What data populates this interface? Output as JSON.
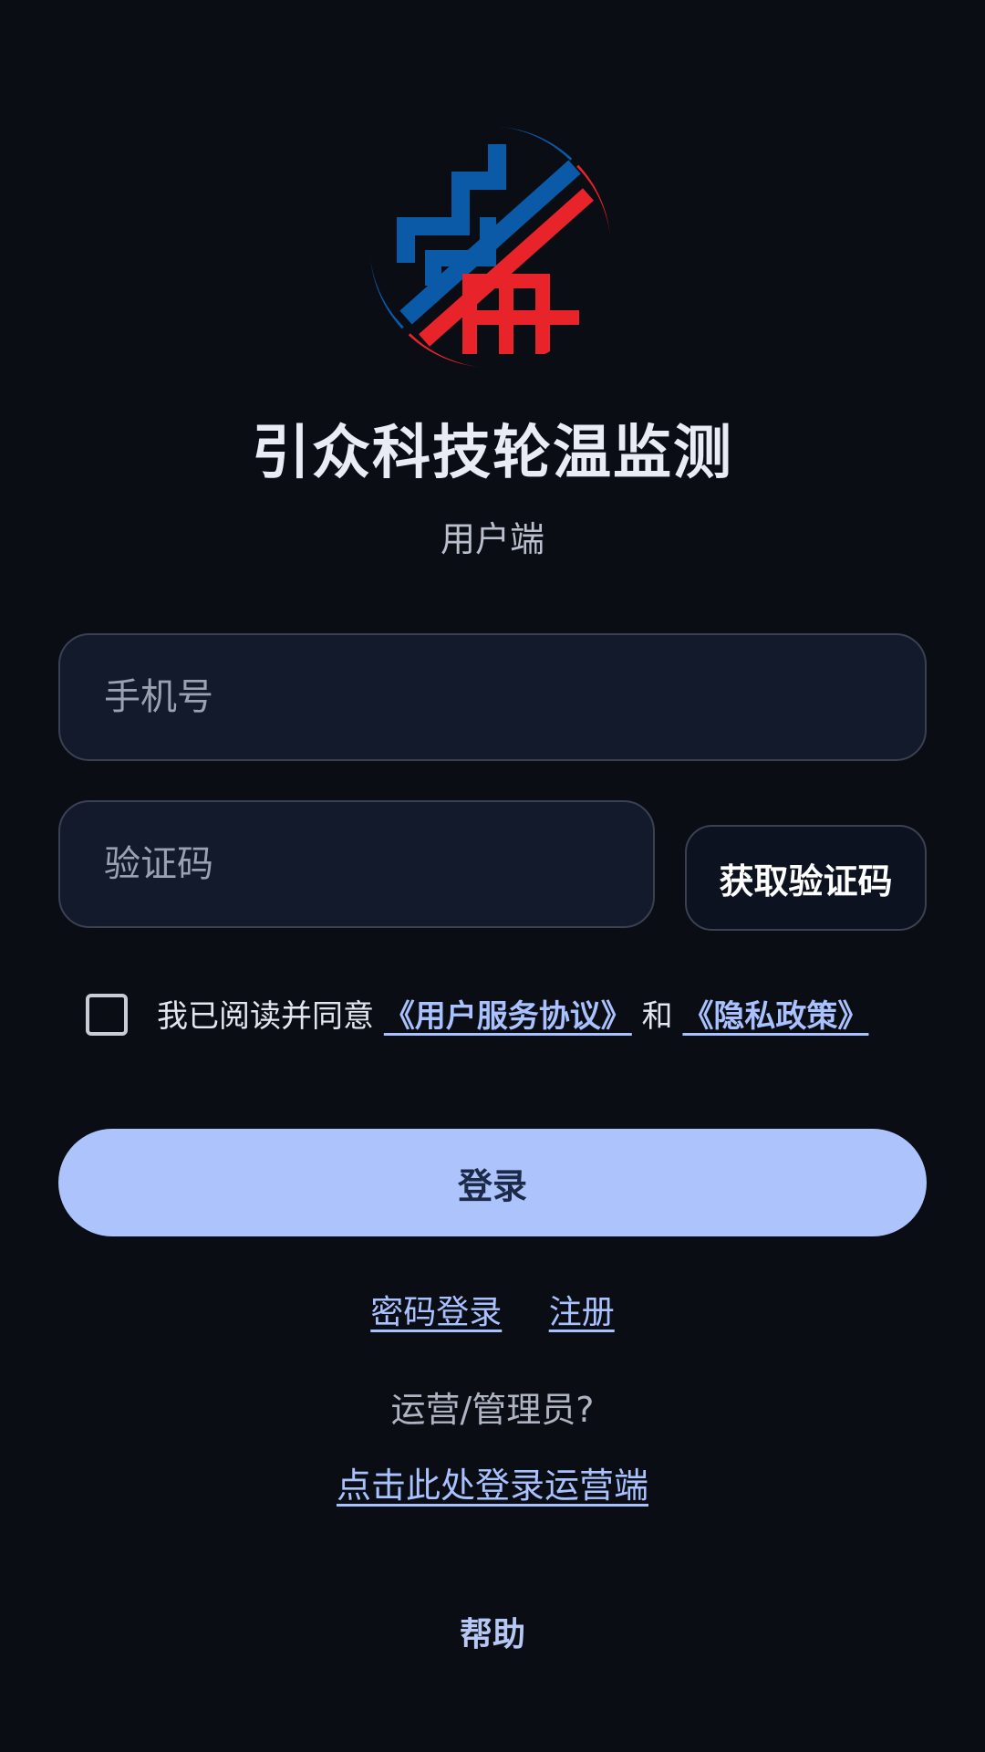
{
  "app": {
    "title": "引众科技轮温监测",
    "subtitle": "用户端"
  },
  "form": {
    "phone_placeholder": "手机号",
    "code_placeholder": "验证码",
    "get_code_label": "获取验证码",
    "agreement_prefix": "我已阅读并同意",
    "terms_link": "《用户服务协议》",
    "agreement_and": "和",
    "privacy_link": "《隐私政策》",
    "agreed": false
  },
  "actions": {
    "login_label": "登录",
    "password_login_label": "密码登录",
    "register_label": "注册",
    "operator_question": "运营/管理员?",
    "operator_login_label": "点击此处登录运营端",
    "help_label": "帮助"
  },
  "colors": {
    "background": "#0a0d14",
    "logo_blue": "#0a5aa8",
    "logo_red": "#e8242a",
    "accent": "#adc3fb",
    "link": "#a9c2ff"
  }
}
